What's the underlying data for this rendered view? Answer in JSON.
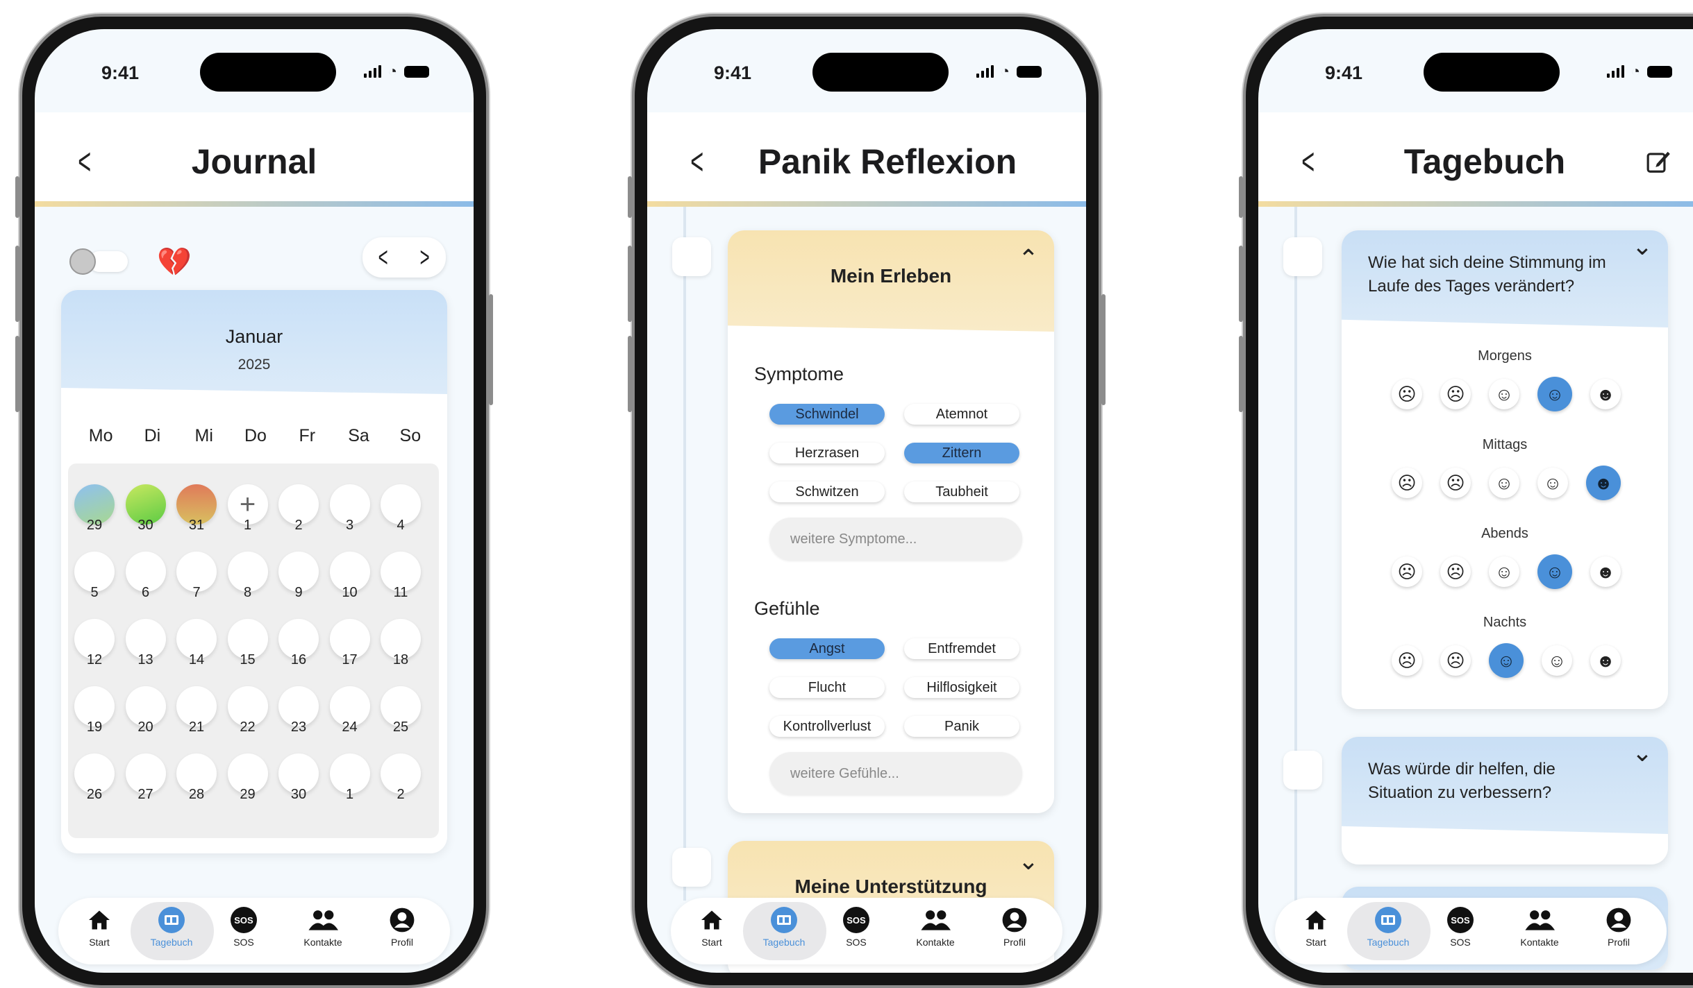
{
  "status": {
    "time": "9:41"
  },
  "nav": {
    "start": "Start",
    "tagebuch": "Tagebuch",
    "sos": "SOS",
    "kontakte": "Kontakte",
    "profil": "Profil",
    "sos_icon": "SOS"
  },
  "journal": {
    "title": "Journal",
    "month": "Januar",
    "year": "2025",
    "weekdays": [
      "Mo",
      "Di",
      "Mi",
      "Do",
      "Fr",
      "Sa",
      "So"
    ],
    "days": [
      "29",
      "30",
      "31",
      "1",
      "2",
      "3",
      "4",
      "5",
      "6",
      "7",
      "8",
      "9",
      "10",
      "11",
      "12",
      "13",
      "14",
      "15",
      "16",
      "17",
      "18",
      "19",
      "20",
      "21",
      "22",
      "23",
      "24",
      "25",
      "26",
      "27",
      "28",
      "29",
      "30",
      "1",
      "2"
    ],
    "add_symbol": "+",
    "prev": "<",
    "next": ">",
    "heart_icon": "💔"
  },
  "panik": {
    "title": "Panik Reflexion",
    "section1": "Mein Erleben",
    "symptome_label": "Symptome",
    "symptome": [
      {
        "label": "Schwindel",
        "on": true
      },
      {
        "label": "Atemnot",
        "on": false
      },
      {
        "label": "Herzrasen",
        "on": false
      },
      {
        "label": "Zittern",
        "on": true
      },
      {
        "label": "Schwitzen",
        "on": false
      },
      {
        "label": "Taubheit",
        "on": false
      }
    ],
    "symptome_placeholder": "weitere Symptome...",
    "gefuehle_label": "Gefühle",
    "gefuehle": [
      {
        "label": "Angst",
        "on": true
      },
      {
        "label": "Entfremdet",
        "on": false
      },
      {
        "label": "Flucht",
        "on": false
      },
      {
        "label": "Hilflosigkeit",
        "on": false
      },
      {
        "label": "Kontrollverlust",
        "on": false
      },
      {
        "label": "Panik",
        "on": false
      }
    ],
    "gefuehle_placeholder": "weitere Gefühle...",
    "section2": "Meine Unterstützung"
  },
  "tagebuch": {
    "title": "Tagebuch",
    "q1": "Wie hat sich deine Stimmung im Laufe des Tages verändert?",
    "times": [
      {
        "label": "Morgens",
        "selected": 3
      },
      {
        "label": "Mittags",
        "selected": 4
      },
      {
        "label": "Abends",
        "selected": 3
      },
      {
        "label": "Nachts",
        "selected": 2
      }
    ],
    "q2": "Was würde dir helfen, die Situation zu verbessern?"
  },
  "colors": {
    "accent": "#4a90d9",
    "chip_on": "#5a9be0",
    "card_blue": "#c9e0f7",
    "card_yellow": "#f7e3b1"
  }
}
